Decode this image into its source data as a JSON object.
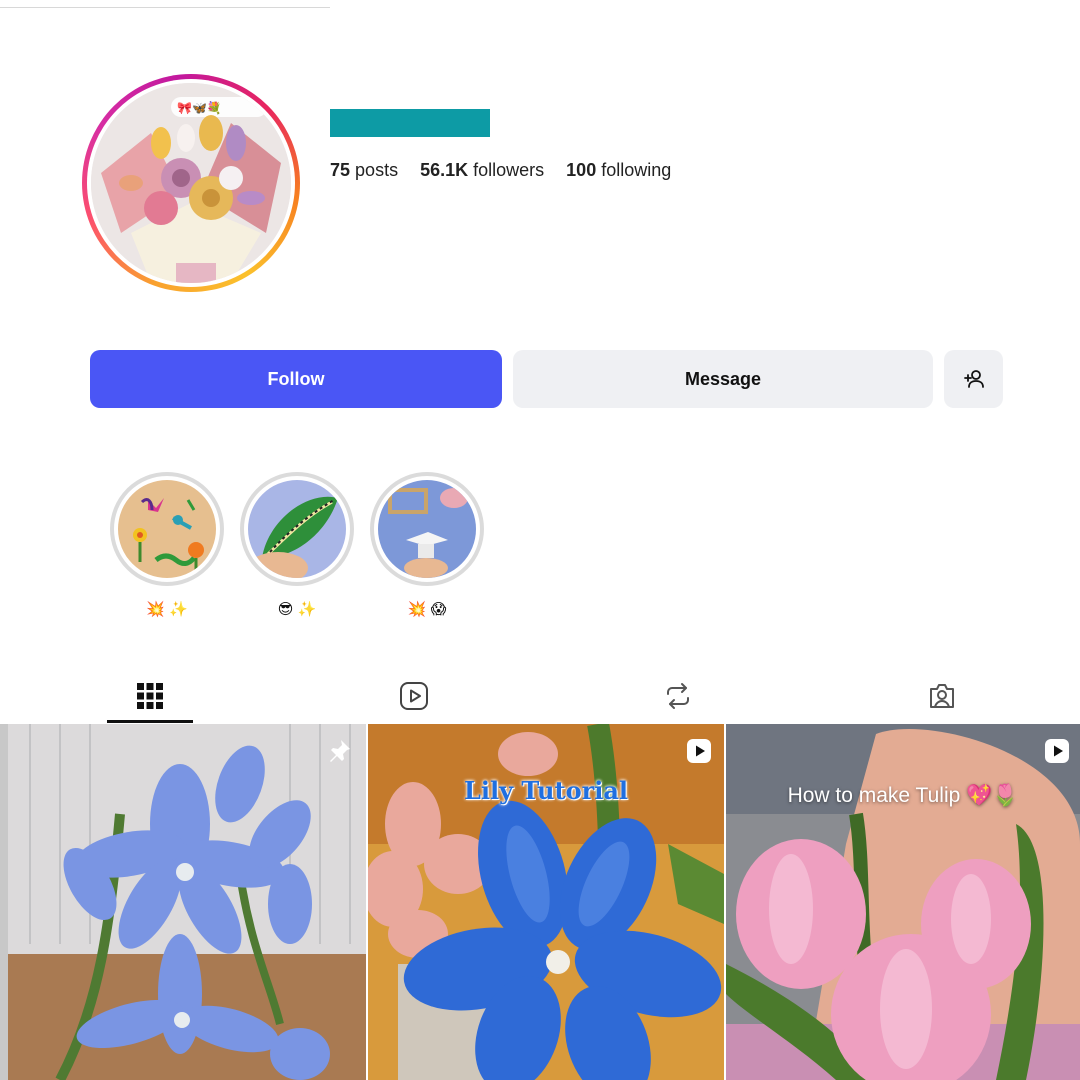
{
  "profile": {
    "stats": [
      {
        "value": "75",
        "label": "posts"
      },
      {
        "value": "56.1K",
        "label": "followers"
      },
      {
        "value": "100",
        "label": "following"
      }
    ],
    "username_redacted_color": "#0d9ba5"
  },
  "actions": {
    "follow_label": "Follow",
    "message_label": "Message",
    "follow_color": "#4a56f5"
  },
  "highlights": [
    {
      "label": "💥 ✨"
    },
    {
      "label": "😎 ✨"
    },
    {
      "label": "💥 😱"
    }
  ],
  "tabs": [
    {
      "icon": "grid-icon",
      "active": true
    },
    {
      "icon": "reels-icon",
      "active": false
    },
    {
      "icon": "reposts-icon",
      "active": false
    },
    {
      "icon": "tagged-icon",
      "active": false
    }
  ],
  "posts": [
    {
      "badge": "pin-icon",
      "caption": ""
    },
    {
      "badge": "reel-icon",
      "caption": "Lily Tutorial"
    },
    {
      "badge": "reel-icon",
      "caption": "How to make Tulip 💖🌷"
    }
  ]
}
